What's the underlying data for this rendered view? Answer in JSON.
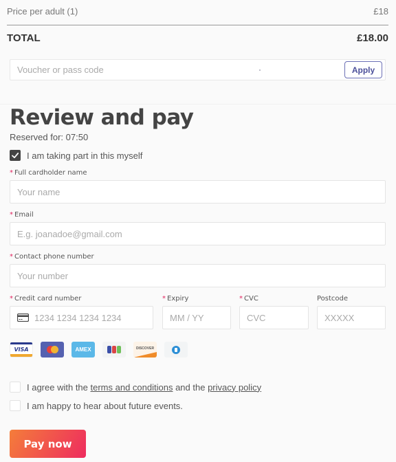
{
  "summary": {
    "price_label": "Price per adult (1)",
    "price_value": "£18",
    "total_label": "TOTAL",
    "total_value": "£18.00"
  },
  "voucher": {
    "placeholder": "Voucher or pass code",
    "apply_label": "Apply"
  },
  "review": {
    "title": "Review and pay",
    "reserved": "Reserved for: 07:50",
    "self_participation": {
      "label": "I am taking part in this myself",
      "checked": true
    }
  },
  "form": {
    "name": {
      "required": "*",
      "label": "Full cardholder name",
      "placeholder": "Your name"
    },
    "email": {
      "required": "*",
      "label": "Email",
      "placeholder": "E.g. joanadoe@gmail.com"
    },
    "phone": {
      "required": "*",
      "label": "Contact phone number",
      "placeholder": "Your number"
    },
    "card": {
      "required": "*",
      "label": "Credit card number",
      "placeholder": "1234 1234 1234 1234"
    },
    "expiry": {
      "required": "*",
      "label": "Expiry",
      "placeholder": "MM / YY"
    },
    "cvc": {
      "required": "*",
      "label": "CVC",
      "placeholder": "CVC"
    },
    "postcode": {
      "label": "Postcode",
      "placeholder": "XXXXX"
    }
  },
  "card_brands": [
    {
      "name": "visa",
      "label": "VISA"
    },
    {
      "name": "mastercard",
      "label": ""
    },
    {
      "name": "amex",
      "label": "AMEX"
    },
    {
      "name": "jcb",
      "label": ""
    },
    {
      "name": "discover",
      "label": "DISCOVER"
    },
    {
      "name": "diners",
      "label": ""
    }
  ],
  "consents": {
    "terms": {
      "prefix": "I agree with the ",
      "terms_link": "terms and conditions",
      "middle": " and the ",
      "privacy_link": "privacy policy",
      "checked": false
    },
    "newsletter": {
      "label": "I am happy to hear about future events.",
      "checked": false
    }
  },
  "pay_button": {
    "label": "Pay now"
  },
  "colors": {
    "accent_start": "#f47d3a",
    "accent_end": "#ee2c5f",
    "required": "#e0245e",
    "apply": "#4b4f9a"
  }
}
